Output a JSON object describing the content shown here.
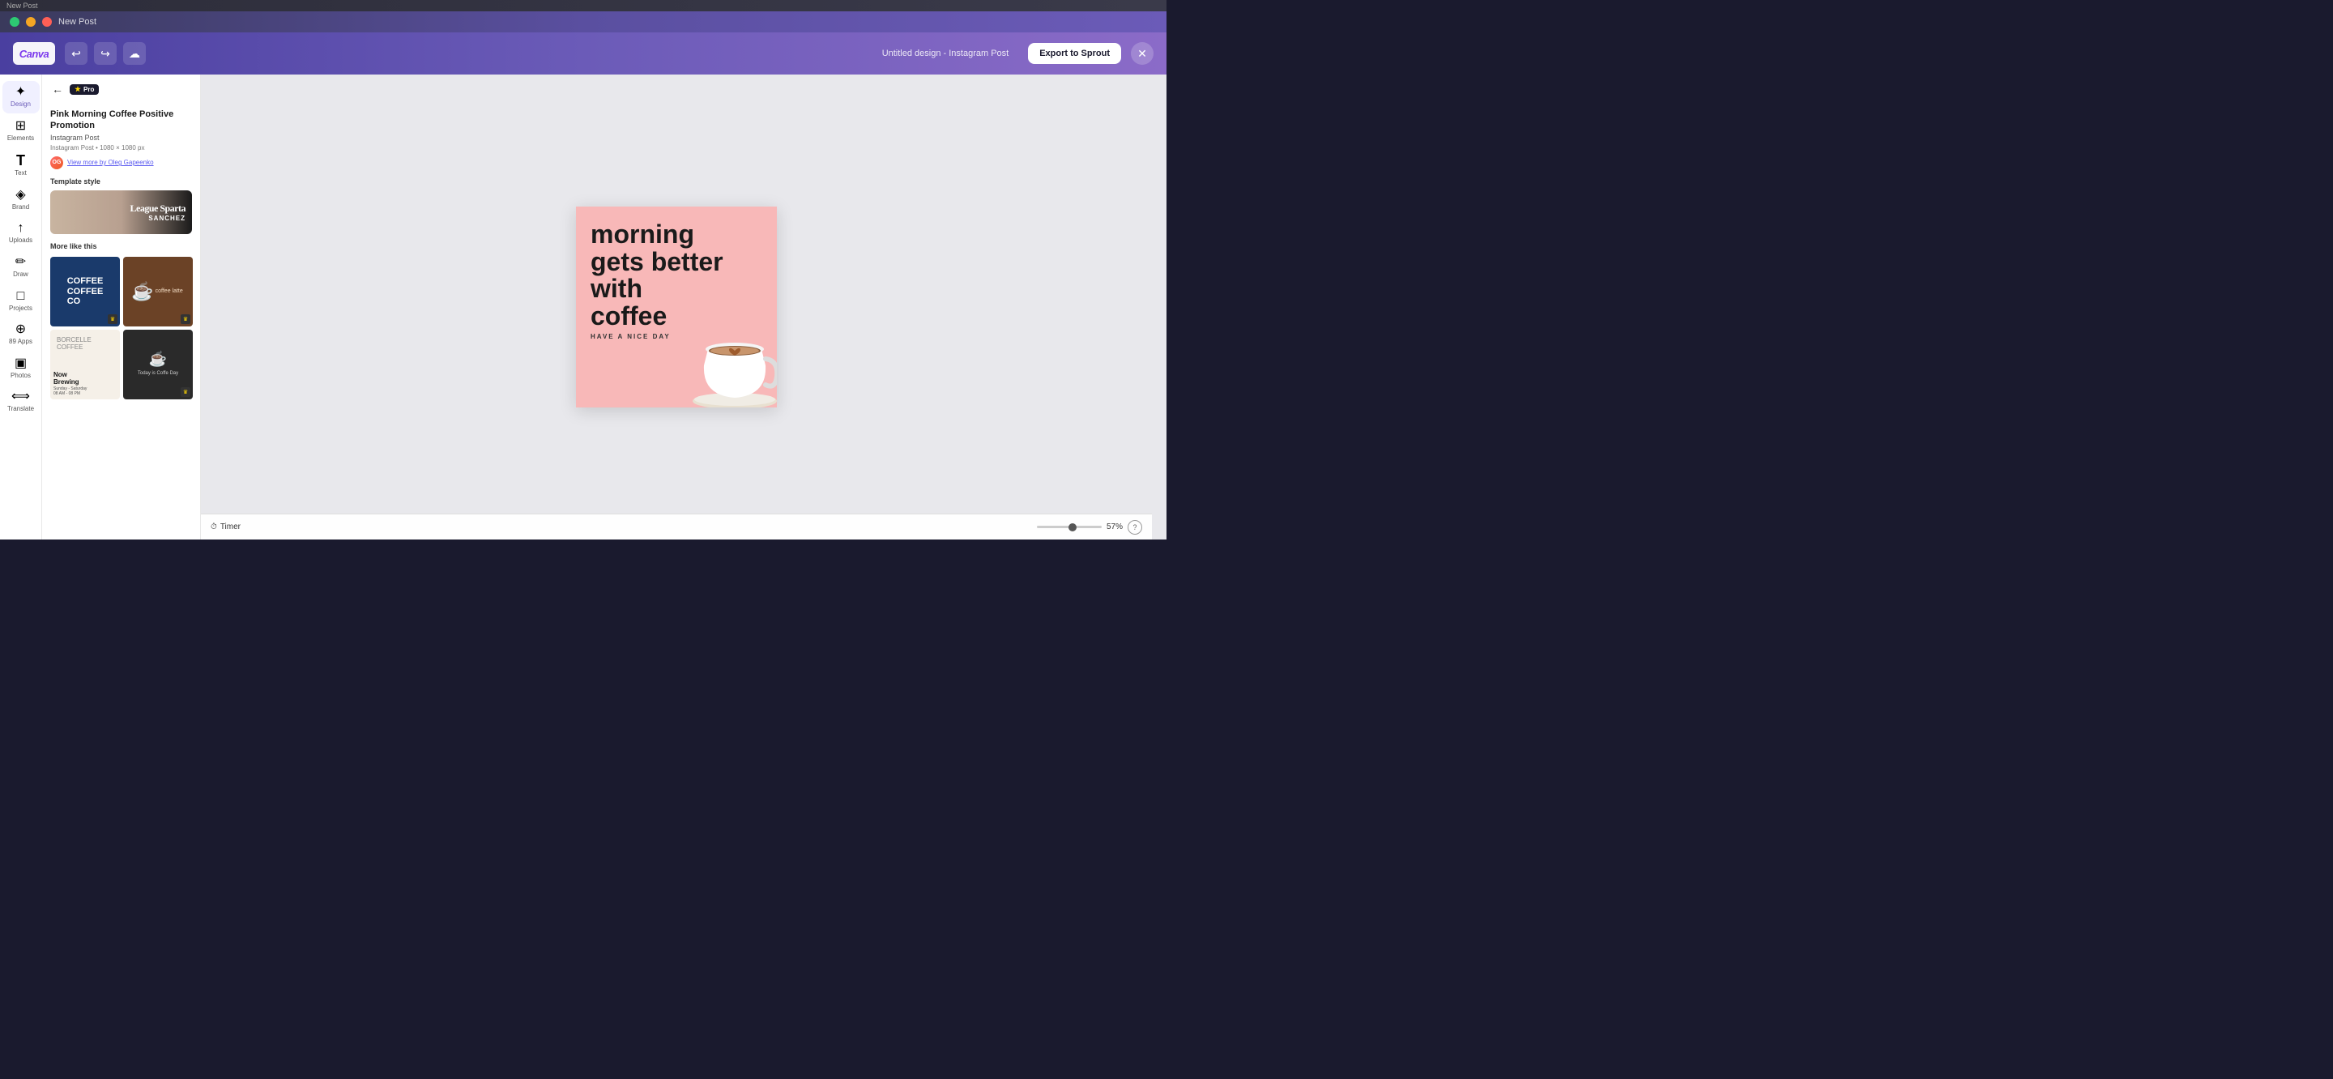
{
  "os_bar": {
    "title": "New Post"
  },
  "topbar": {
    "logo": "Canva",
    "title": "Untitled design - Instagram Post",
    "export_label": "Export to Sprout",
    "undo_icon": "undo",
    "redo_icon": "redo",
    "save_icon": "cloud-save",
    "close_icon": "close"
  },
  "sidebar": {
    "items": [
      {
        "id": "design",
        "label": "Design",
        "icon": "✦",
        "active": true
      },
      {
        "id": "elements",
        "label": "Elements",
        "icon": "⊞"
      },
      {
        "id": "text",
        "label": "Text",
        "icon": "T"
      },
      {
        "id": "brand",
        "label": "Brand",
        "icon": "◈"
      },
      {
        "id": "uploads",
        "label": "Uploads",
        "icon": "↑"
      },
      {
        "id": "draw",
        "label": "Draw",
        "icon": "✏"
      },
      {
        "id": "projects",
        "label": "Projects",
        "icon": "□"
      },
      {
        "id": "apps",
        "label": "89 Apps",
        "icon": "⊕"
      },
      {
        "id": "photos",
        "label": "Photos",
        "icon": "▣"
      },
      {
        "id": "translate",
        "label": "Translate",
        "icon": "⟺"
      }
    ]
  },
  "panel": {
    "back_icon": "←",
    "pro_badge": "Pro",
    "template_title": "Pink Morning Coffee Positive Promotion",
    "template_type": "Instagram Post",
    "template_dimensions": "1080 × 1080 px",
    "author_initials": "OG",
    "author_link": "View more by Oleg Gapeenko",
    "template_style_label": "Template style",
    "font_name": "League Sparta",
    "font_sub": "SANCHEZ",
    "more_like_label": "More like this",
    "thumbnails": [
      {
        "id": "thumb1",
        "type": "blue",
        "text": "COFFEE COFFEE CO"
      },
      {
        "id": "thumb2",
        "type": "brown",
        "text": "coffee latte"
      },
      {
        "id": "thumb3",
        "type": "beige",
        "title": "Now Brewing",
        "sub": "BORCELLE COFFEE\nSunday - Saturday\n08 AM - 08 PM"
      },
      {
        "id": "thumb4",
        "type": "dark",
        "text": "Today is Coffe Day"
      }
    ]
  },
  "canvas": {
    "headline_line1": "morning",
    "headline_line2": "gets better",
    "headline_line3": "with",
    "headline_line4": "coffee",
    "subline": "HAVE A NICE DAY",
    "zoom": "57%",
    "timer_label": "Timer"
  }
}
